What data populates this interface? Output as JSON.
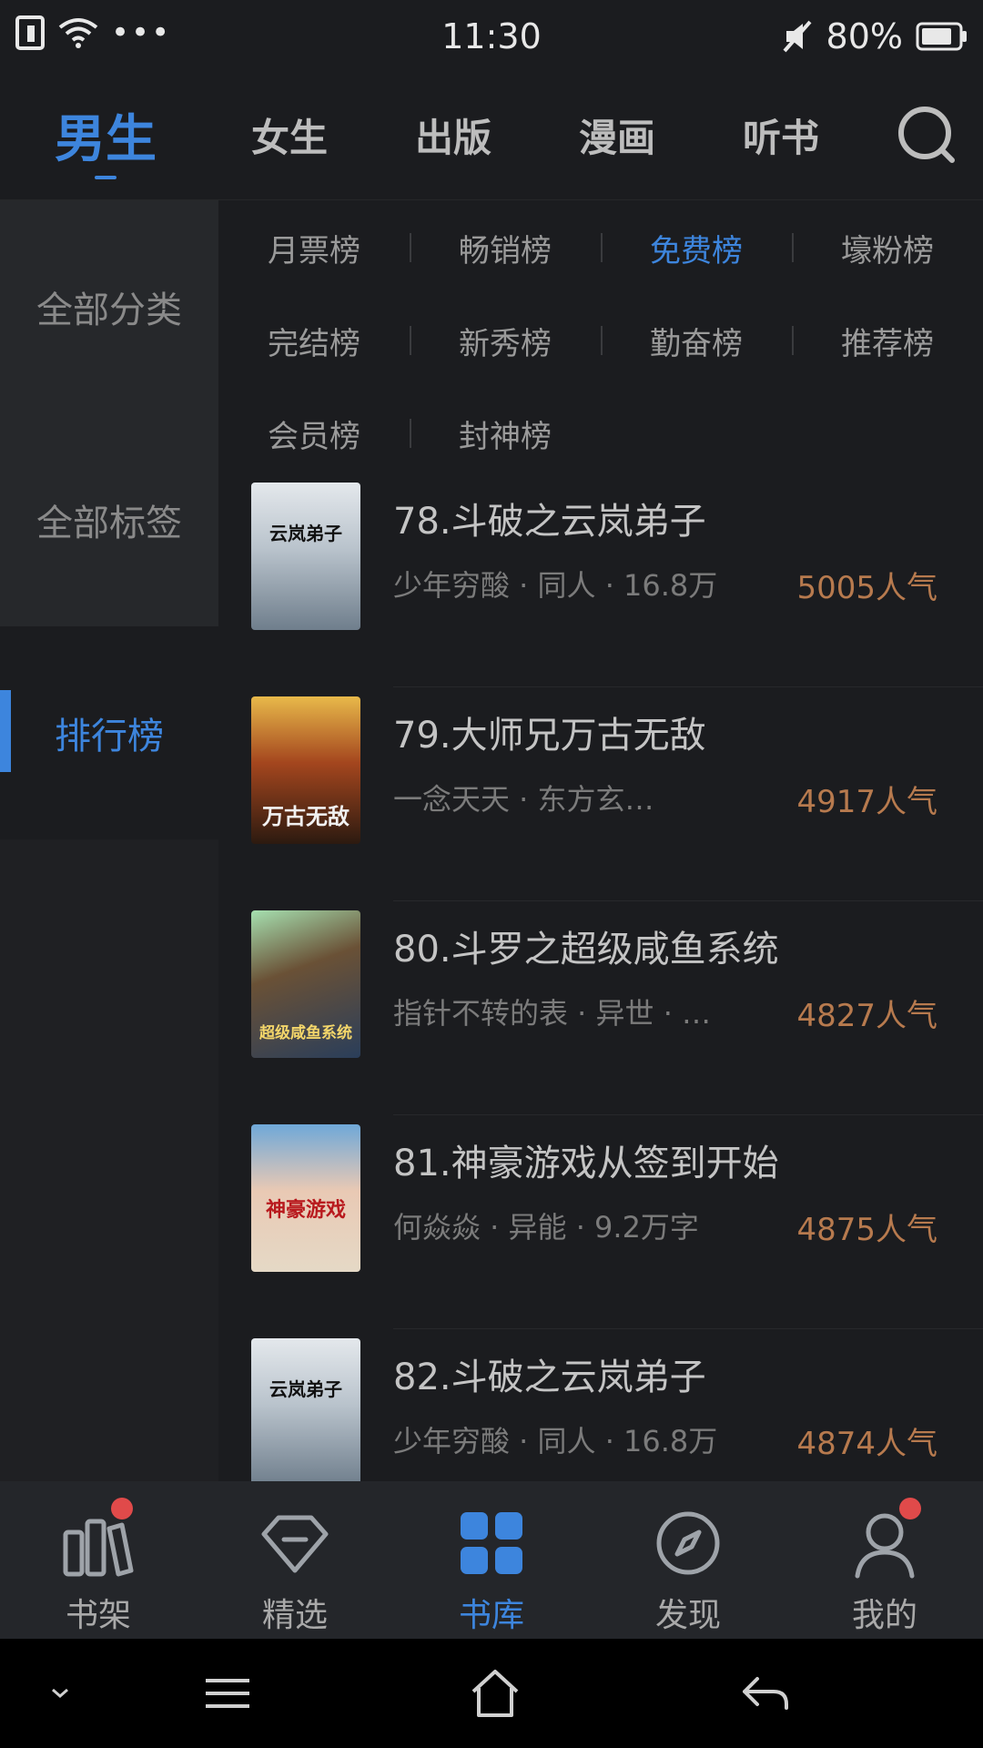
{
  "status_bar": {
    "time": "11:30",
    "battery": "80%"
  },
  "top_nav": {
    "tabs": [
      "男生",
      "女生",
      "出版",
      "漫画",
      "听书"
    ],
    "active_index": 0
  },
  "sidebar": {
    "items": [
      "全部分类",
      "全部标签",
      "排行榜"
    ],
    "active_index": 2
  },
  "rank_tabs": {
    "items": [
      "月票榜",
      "畅销榜",
      "免费榜",
      "壕粉榜",
      "完结榜",
      "新秀榜",
      "勤奋榜",
      "推荐榜",
      "会员榜",
      "封神榜"
    ],
    "active_index": 2
  },
  "books": [
    {
      "title": "78.斗破之云岚弟子",
      "meta": "少年穷酸 · 同人 · 16.8万",
      "popularity": "5005人气",
      "cover_text": "云岚弟子"
    },
    {
      "title": "79.大师兄万古无敌",
      "meta": "一念天天 · 东方玄…",
      "popularity": "4917人气",
      "cover_text": "万古无敌"
    },
    {
      "title": "80.斗罗之超级咸鱼系统",
      "meta": "指针不转的表 · 异世 · …",
      "popularity": "4827人气",
      "cover_text": "超级咸鱼系统"
    },
    {
      "title": "81.神豪游戏从签到开始",
      "meta": "何焱焱 · 异能 · 9.2万字",
      "popularity": "4875人气",
      "cover_text": "神豪游戏"
    },
    {
      "title": "82.斗破之云岚弟子",
      "meta": "少年穷酸 · 同人 · 16.8万",
      "popularity": "4874人气",
      "cover_text": "云岚弟子"
    }
  ],
  "bottom_nav": {
    "items": [
      {
        "label": "书架",
        "icon": "bookshelf-icon",
        "badge": true
      },
      {
        "label": "精选",
        "icon": "diamond-icon",
        "badge": false
      },
      {
        "label": "书库",
        "icon": "grid-icon",
        "badge": false
      },
      {
        "label": "发现",
        "icon": "compass-icon",
        "badge": false
      },
      {
        "label": "我的",
        "icon": "user-icon",
        "badge": true
      }
    ],
    "active_index": 2
  },
  "colors": {
    "accent": "#3d85dd",
    "popularity": "#b77a4e",
    "badge": "#e04a4a",
    "background": "#1b1c1f"
  }
}
